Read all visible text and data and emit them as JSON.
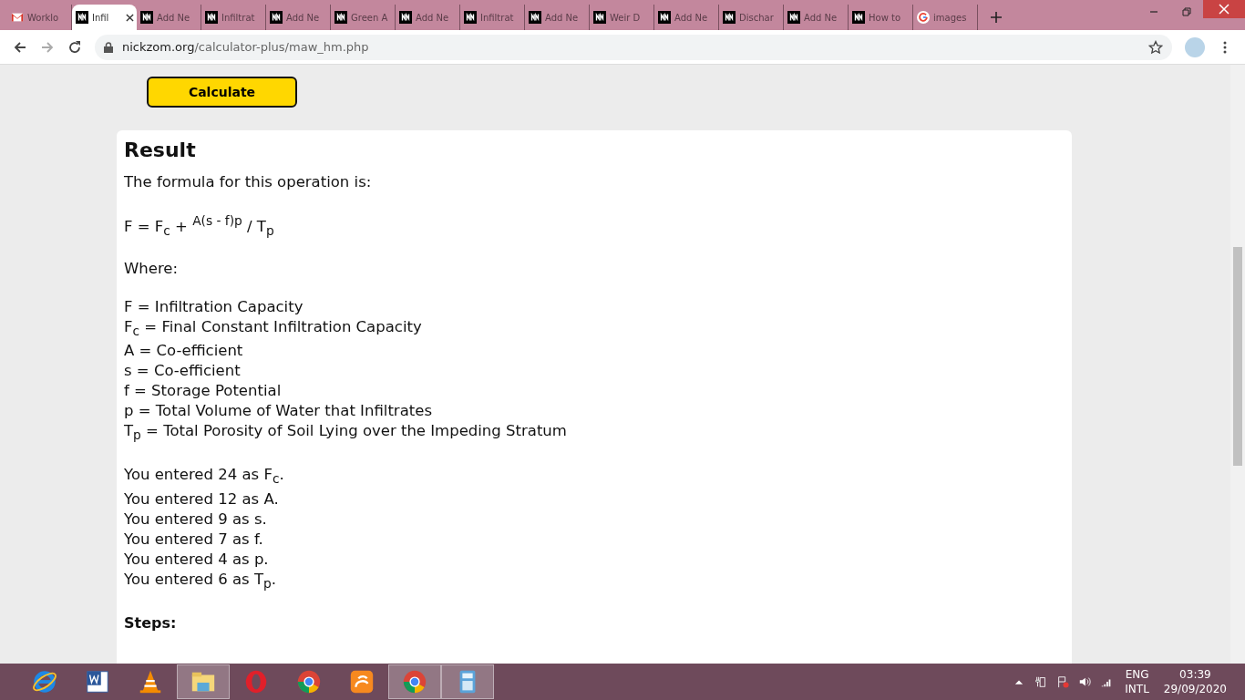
{
  "tabs": [
    {
      "label": "Worklo",
      "kind": "gmail",
      "selected": false
    },
    {
      "label": "Infil",
      "kind": "nickzom",
      "selected": true
    },
    {
      "label": "Add Ne",
      "kind": "nickzom",
      "selected": false
    },
    {
      "label": "Infiltrat",
      "kind": "nickzom",
      "selected": false
    },
    {
      "label": "Add Ne",
      "kind": "nickzom",
      "selected": false
    },
    {
      "label": "Green A",
      "kind": "nickzom",
      "selected": false
    },
    {
      "label": "Add Ne",
      "kind": "nickzom",
      "selected": false
    },
    {
      "label": "Infiltrat",
      "kind": "nickzom",
      "selected": false
    },
    {
      "label": "Add Ne",
      "kind": "nickzom",
      "selected": false
    },
    {
      "label": "Weir D",
      "kind": "nickzom",
      "selected": false
    },
    {
      "label": "Add Ne",
      "kind": "nickzom",
      "selected": false
    },
    {
      "label": "Dischar",
      "kind": "nickzom",
      "selected": false
    },
    {
      "label": "Add Ne",
      "kind": "nickzom",
      "selected": false
    },
    {
      "label": "How to",
      "kind": "nickzom",
      "selected": false
    },
    {
      "label": "images",
      "kind": "google",
      "selected": false
    }
  ],
  "address_bar": {
    "url_host": "nickzom.org",
    "url_path": "/calculator-plus/maw_hm.php"
  },
  "calculate_button": "Calculate",
  "result": {
    "title": "Result",
    "intro": "The formula for this operation is:",
    "formula": "F = F$_{c}$ + $^{A(s - f)p}$ / T$_{p}$",
    "where_label": "Where:",
    "definitions": [
      "F = Infiltration Capacity",
      "F$_{c}$ = Final Constant Infiltration Capacity",
      "A = Co-efficient",
      "s = Co-efficient",
      "f = Storage Potential",
      "p = Total Volume of Water that Infiltrates",
      "T$_{p}$ = Total Porosity of Soil Lying over the Impeding Stratum"
    ],
    "entered": [
      "You entered 24 as F$_{c}$.",
      "You entered 12 as A.",
      "You entered 9 as s.",
      "You entered 7 as f.",
      "You entered 4 as p.",
      "You entered 6 as T$_{p}$."
    ],
    "steps_label": "Steps:"
  },
  "taskbar": {
    "apps": [
      {
        "kind": "ie",
        "selected": false
      },
      {
        "kind": "word",
        "selected": false
      },
      {
        "kind": "vlc",
        "selected": false
      },
      {
        "kind": "explorer",
        "selected": true
      },
      {
        "kind": "opera",
        "selected": false
      },
      {
        "kind": "chrome",
        "selected": false
      },
      {
        "kind": "uc",
        "selected": false
      },
      {
        "kind": "chrome",
        "selected": true
      },
      {
        "kind": "calculator",
        "selected": true
      }
    ],
    "language": "ENG",
    "layout": "INTL",
    "time": "03:39",
    "date": "29/09/2020"
  }
}
